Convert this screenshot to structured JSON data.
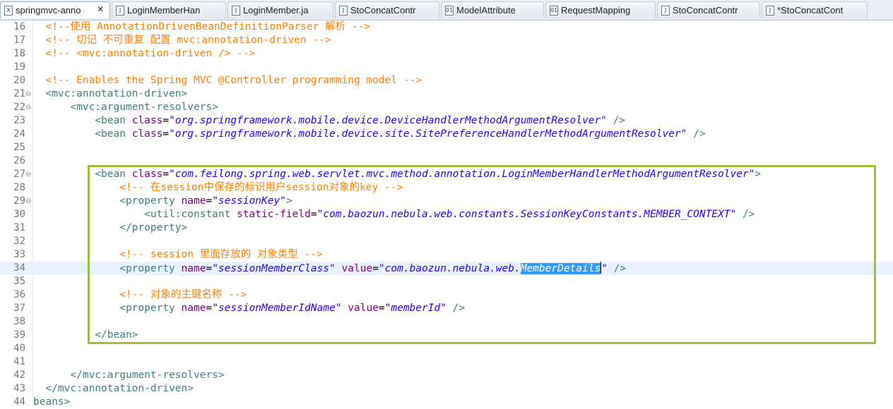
{
  "tabs": [
    {
      "label": "springmvc-anno",
      "icon": "xml-file-icon",
      "glyph": "X",
      "active": true,
      "close": "✕"
    },
    {
      "label": "LoginMemberHan",
      "icon": "java-file-icon",
      "glyph": "J"
    },
    {
      "label": "LoginMember.ja",
      "icon": "java-file-icon",
      "glyph": "J"
    },
    {
      "label": "StoConcatContr",
      "icon": "java-file-icon",
      "glyph": "J"
    },
    {
      "label": "ModelAttribute",
      "icon": "class-file-icon",
      "glyph": "01"
    },
    {
      "label": "RequestMapping",
      "icon": "class-file-icon",
      "glyph": "01"
    },
    {
      "label": "StoConcatContr",
      "icon": "java-file-icon",
      "glyph": "J"
    },
    {
      "label": "*StoConcatCont",
      "icon": "java-file-icon",
      "glyph": "J"
    }
  ],
  "lines": [
    {
      "n": "16",
      "parts": [
        {
          "t": "  ",
          "c": ""
        },
        {
          "t": "<!--使用 AnnotationDrivenBeanDefinitionParser 解析 -->",
          "c": "cmt"
        }
      ]
    },
    {
      "n": "17",
      "parts": [
        {
          "t": "  ",
          "c": ""
        },
        {
          "t": "<!-- 切记 不可重复 配置 mvc:annotation-driven -->",
          "c": "cmt"
        }
      ]
    },
    {
      "n": "18",
      "parts": [
        {
          "t": "  ",
          "c": ""
        },
        {
          "t": "<!-- <mvc:annotation-driven /> -->",
          "c": "cmt"
        }
      ]
    },
    {
      "n": "19",
      "parts": []
    },
    {
      "n": "20",
      "parts": [
        {
          "t": "  ",
          "c": ""
        },
        {
          "t": "<!-- Enables the Spring MVC @Controller programming model -->",
          "c": "cmt"
        }
      ]
    },
    {
      "n": "21",
      "fold": "⊖",
      "parts": [
        {
          "t": "  ",
          "c": ""
        },
        {
          "t": "<mvc:annotation-driven>",
          "c": "tag"
        }
      ]
    },
    {
      "n": "22",
      "fold": "⊖",
      "parts": [
        {
          "t": "      ",
          "c": ""
        },
        {
          "t": "<mvc:argument-resolvers>",
          "c": "tag"
        }
      ]
    },
    {
      "n": "23",
      "parts": [
        {
          "t": "          ",
          "c": ""
        },
        {
          "t": "<bean ",
          "c": "tag"
        },
        {
          "t": "class",
          "c": "attr"
        },
        {
          "t": "=",
          "c": ""
        },
        {
          "t": "\"org.springframework.mobile.device.DeviceHandlerMethodArgumentResolver\"",
          "c": "val"
        },
        {
          "t": " />",
          "c": "tag"
        }
      ]
    },
    {
      "n": "24",
      "parts": [
        {
          "t": "          ",
          "c": ""
        },
        {
          "t": "<bean ",
          "c": "tag"
        },
        {
          "t": "class",
          "c": "attr"
        },
        {
          "t": "=",
          "c": ""
        },
        {
          "t": "\"org.springframework.mobile.device.site.SitePreferenceHandlerMethodArgumentResolver\"",
          "c": "val"
        },
        {
          "t": " />",
          "c": "tag"
        }
      ]
    },
    {
      "n": "25",
      "parts": []
    },
    {
      "n": "26",
      "parts": []
    },
    {
      "n": "27",
      "fold": "⊖",
      "parts": [
        {
          "t": "          ",
          "c": ""
        },
        {
          "t": "<bean ",
          "c": "tag"
        },
        {
          "t": "class",
          "c": "attr"
        },
        {
          "t": "=",
          "c": ""
        },
        {
          "t": "\"com.feilong.spring.web.servlet.mvc.method.annotation.LoginMemberHandlerMethodArgumentResolver\"",
          "c": "val"
        },
        {
          "t": ">",
          "c": "tag"
        }
      ]
    },
    {
      "n": "28",
      "parts": [
        {
          "t": "              ",
          "c": ""
        },
        {
          "t": "<!-- 在session中保存的标识用户session对象的key -->",
          "c": "cmt"
        }
      ]
    },
    {
      "n": "29",
      "fold": "⊖",
      "parts": [
        {
          "t": "              ",
          "c": ""
        },
        {
          "t": "<property ",
          "c": "tag"
        },
        {
          "t": "name",
          "c": "attr"
        },
        {
          "t": "=",
          "c": ""
        },
        {
          "t": "\"sessionKey\"",
          "c": "val"
        },
        {
          "t": ">",
          "c": "tag"
        }
      ]
    },
    {
      "n": "30",
      "parts": [
        {
          "t": "                  ",
          "c": ""
        },
        {
          "t": "<util:constant ",
          "c": "tag"
        },
        {
          "t": "static-field",
          "c": "attr"
        },
        {
          "t": "=",
          "c": ""
        },
        {
          "t": "\"com.baozun.nebula.web.constants.SessionKeyConstants.MEMBER_CONTEXT\"",
          "c": "val"
        },
        {
          "t": " />",
          "c": "tag"
        }
      ]
    },
    {
      "n": "31",
      "parts": [
        {
          "t": "              ",
          "c": ""
        },
        {
          "t": "</property>",
          "c": "tag"
        }
      ]
    },
    {
      "n": "32",
      "parts": []
    },
    {
      "n": "33",
      "parts": [
        {
          "t": "              ",
          "c": ""
        },
        {
          "t": "<!-- session 里面存放的 对象类型 -->",
          "c": "cmt"
        }
      ]
    },
    {
      "n": "34",
      "current": true,
      "parts": [
        {
          "t": "              ",
          "c": ""
        },
        {
          "t": "<property ",
          "c": "tag"
        },
        {
          "t": "name",
          "c": "attr"
        },
        {
          "t": "=",
          "c": ""
        },
        {
          "t": "\"sessionMemberClass\"",
          "c": "val"
        },
        {
          "t": " ",
          "c": ""
        },
        {
          "t": "value",
          "c": "attr"
        },
        {
          "t": "=",
          "c": ""
        },
        {
          "t": "\"com.baozun.nebula.web.",
          "c": "val"
        },
        {
          "t": "MemberDetails",
          "c": "sel"
        },
        {
          "t": "|",
          "c": "cursor"
        },
        {
          "t": "\"",
          "c": "val"
        },
        {
          "t": " />",
          "c": "tag"
        }
      ]
    },
    {
      "n": "35",
      "parts": []
    },
    {
      "n": "36",
      "parts": [
        {
          "t": "              ",
          "c": ""
        },
        {
          "t": "<!-- 对象的主键名称 -->",
          "c": "cmt"
        }
      ]
    },
    {
      "n": "37",
      "parts": [
        {
          "t": "              ",
          "c": ""
        },
        {
          "t": "<property ",
          "c": "tag"
        },
        {
          "t": "name",
          "c": "attr"
        },
        {
          "t": "=",
          "c": ""
        },
        {
          "t": "\"sessionMemberIdName\"",
          "c": "val"
        },
        {
          "t": " ",
          "c": ""
        },
        {
          "t": "value",
          "c": "attr"
        },
        {
          "t": "=",
          "c": ""
        },
        {
          "t": "\"memberId\"",
          "c": "val"
        },
        {
          "t": " />",
          "c": "tag"
        }
      ]
    },
    {
      "n": "38",
      "parts": []
    },
    {
      "n": "39",
      "parts": [
        {
          "t": "          ",
          "c": ""
        },
        {
          "t": "</bean>",
          "c": "tag"
        }
      ]
    },
    {
      "n": "40",
      "parts": []
    },
    {
      "n": "41",
      "parts": []
    },
    {
      "n": "42",
      "parts": [
        {
          "t": "      ",
          "c": ""
        },
        {
          "t": "</mvc:argument-resolvers>",
          "c": "tag"
        }
      ]
    },
    {
      "n": "43",
      "parts": [
        {
          "t": "  ",
          "c": ""
        },
        {
          "t": "</mvc:annotation-driven>",
          "c": "tag"
        }
      ]
    },
    {
      "n": "44",
      "parts": [
        {
          "t": "beans>",
          "c": "tag"
        }
      ]
    }
  ],
  "highlight_box_color": "#9bc13a"
}
